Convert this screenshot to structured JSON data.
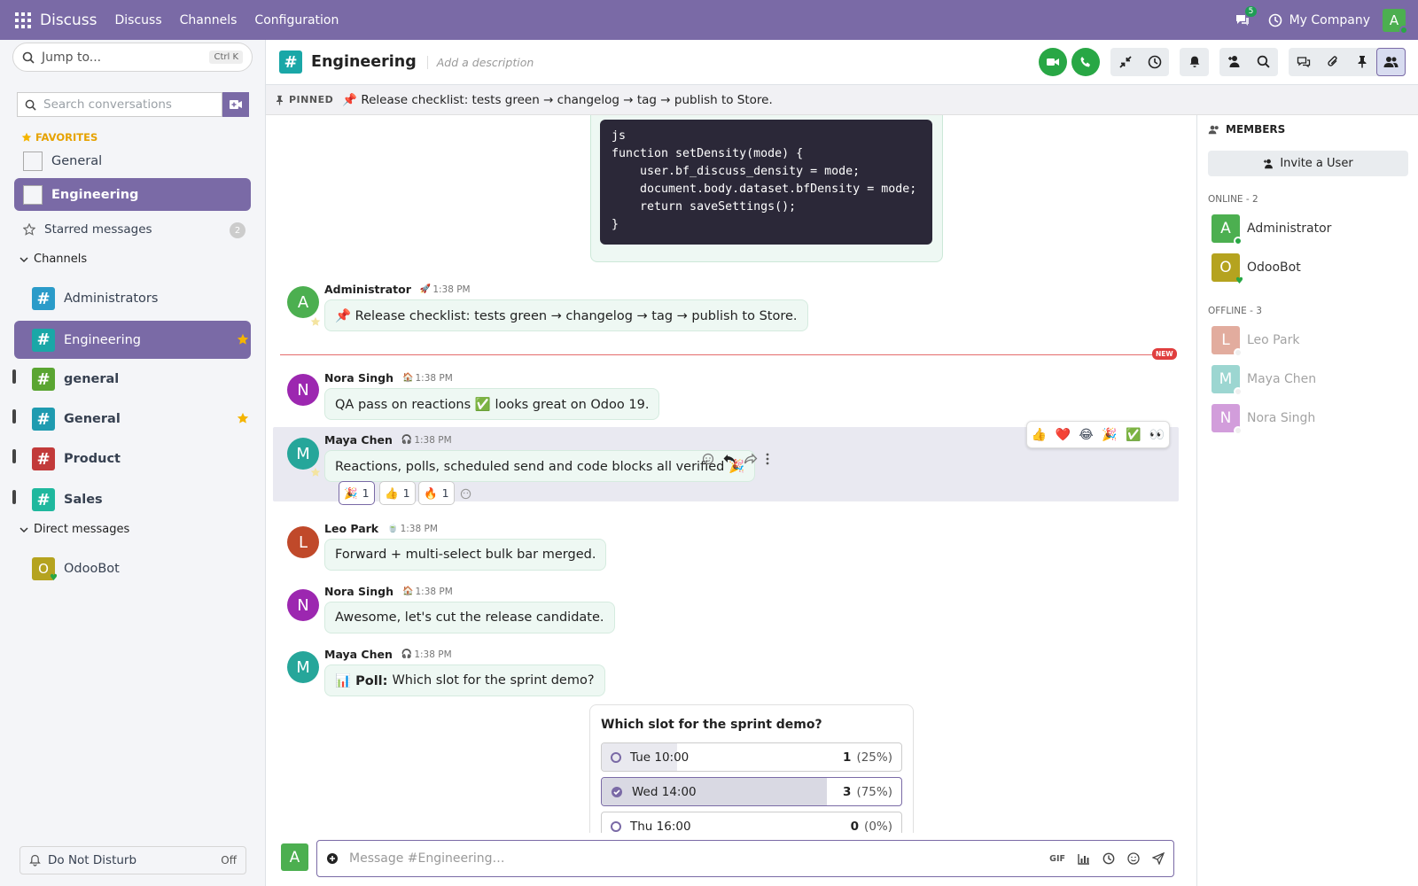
{
  "topnav": {
    "app_name": "Discuss",
    "menus": [
      "Discuss",
      "Channels",
      "Configuration"
    ],
    "chat_badge": "5",
    "company": "My Company",
    "user_initial": "A"
  },
  "sidebar": {
    "jump_placeholder": "Jump to...",
    "jump_shortcut": "Ctrl K",
    "search_placeholder": "Search conversations",
    "favorites_label": "FAVORITES",
    "favorites": [
      {
        "label": "General"
      },
      {
        "label": "Engineering"
      }
    ],
    "starred_label": "Starred messages",
    "starred_count": "2",
    "channels_label": "Channels",
    "channels": [
      {
        "label": "Administrators",
        "color": "#2a9bc9"
      },
      {
        "label": "Engineering",
        "color": "#1aa7a7"
      },
      {
        "label": "general",
        "color": "#5aa532"
      },
      {
        "label": "General",
        "color": "#1f9bb0"
      },
      {
        "label": "Product",
        "color": "#c23a3a"
      },
      {
        "label": "Sales",
        "color": "#1fb89e"
      }
    ],
    "dm_label": "Direct messages",
    "dms": [
      {
        "label": "OdooBot",
        "initial": "O"
      }
    ],
    "dnd_label": "Do Not Disturb",
    "dnd_state": "Off"
  },
  "header": {
    "channel_name": "Engineering",
    "description_placeholder": "Add a description"
  },
  "pinned": {
    "label": "PINNED",
    "text": "📌 Release checklist: tests green → changelog → tag → publish to Store."
  },
  "code_block": "js\nfunction setDensity(mode) {\n    user.bf_discuss_density = mode;\n    document.body.dataset.bfDensity = mode;\n    return saveSettings();\n}",
  "new_tag": "NEW",
  "messages": [
    {
      "author": "Administrator",
      "initial": "A",
      "time": "1:38 PM",
      "status": "🚀",
      "text": "📌 Release checklist: tests green → changelog → tag → publish to Store.",
      "color": "#4caf50"
    },
    {
      "author": "Nora Singh",
      "initial": "N",
      "time": "1:38 PM",
      "status": "🏠",
      "text": "QA pass on reactions ✅ looks great on Odoo 19.",
      "color": "#9c27b0"
    },
    {
      "author": "Maya Chen",
      "initial": "M",
      "time": "1:38 PM",
      "status": "🎧",
      "text": "Reactions, polls, scheduled send and code blocks all verified 🎉",
      "color": "#26a69a"
    },
    {
      "author": "Leo Park",
      "initial": "L",
      "time": "1:38 PM",
      "status": "🍵",
      "text": "Forward + multi-select bulk bar merged.",
      "color": "#c0492a"
    },
    {
      "author": "Nora Singh",
      "initial": "N",
      "time": "1:38 PM",
      "status": "🏠",
      "text": "Awesome, let's cut the release candidate.",
      "color": "#9c27b0"
    },
    {
      "author": "Maya Chen",
      "initial": "M",
      "time": "1:38 PM",
      "status": "🎧",
      "text": "Which slot for the sprint demo?",
      "prefix": "📊 Poll:",
      "color": "#26a69a"
    }
  ],
  "reaction_picker": [
    "👍",
    "❤️",
    "😂",
    "🎉",
    "✅",
    "👀"
  ],
  "reactions": [
    {
      "emoji": "🎉",
      "count": "1"
    },
    {
      "emoji": "👍",
      "count": "1"
    },
    {
      "emoji": "🔥",
      "count": "1"
    }
  ],
  "poll": {
    "question": "Which slot for the sprint demo?",
    "options": [
      {
        "label": "Tue 10:00",
        "count": "1",
        "pct": "(25%)",
        "share": 0.25,
        "voted": false
      },
      {
        "label": "Wed 14:00",
        "count": "3",
        "pct": "(75%)",
        "share": 0.75,
        "voted": true
      },
      {
        "label": "Thu 16:00",
        "count": "0",
        "pct": "(0%)",
        "share": 0,
        "voted": false
      }
    ]
  },
  "composer": {
    "user_initial": "A",
    "placeholder": "Message #Engineering…",
    "gif_label": "GIF"
  },
  "members": {
    "title": "MEMBERS",
    "invite_label": "Invite a User",
    "online_label": "ONLINE - 2",
    "online": [
      {
        "name": "Administrator",
        "initial": "A",
        "color": "#4caf50"
      },
      {
        "name": "OdooBot",
        "initial": "O",
        "color": "#b5a31f"
      }
    ],
    "offline_label": "OFFLINE - 3",
    "offline": [
      {
        "name": "Leo Park",
        "initial": "L",
        "color": "#c0492a"
      },
      {
        "name": "Maya Chen",
        "initial": "M",
        "color": "#26a69a"
      },
      {
        "name": "Nora Singh",
        "initial": "N",
        "color": "#9c27b0"
      }
    ]
  }
}
